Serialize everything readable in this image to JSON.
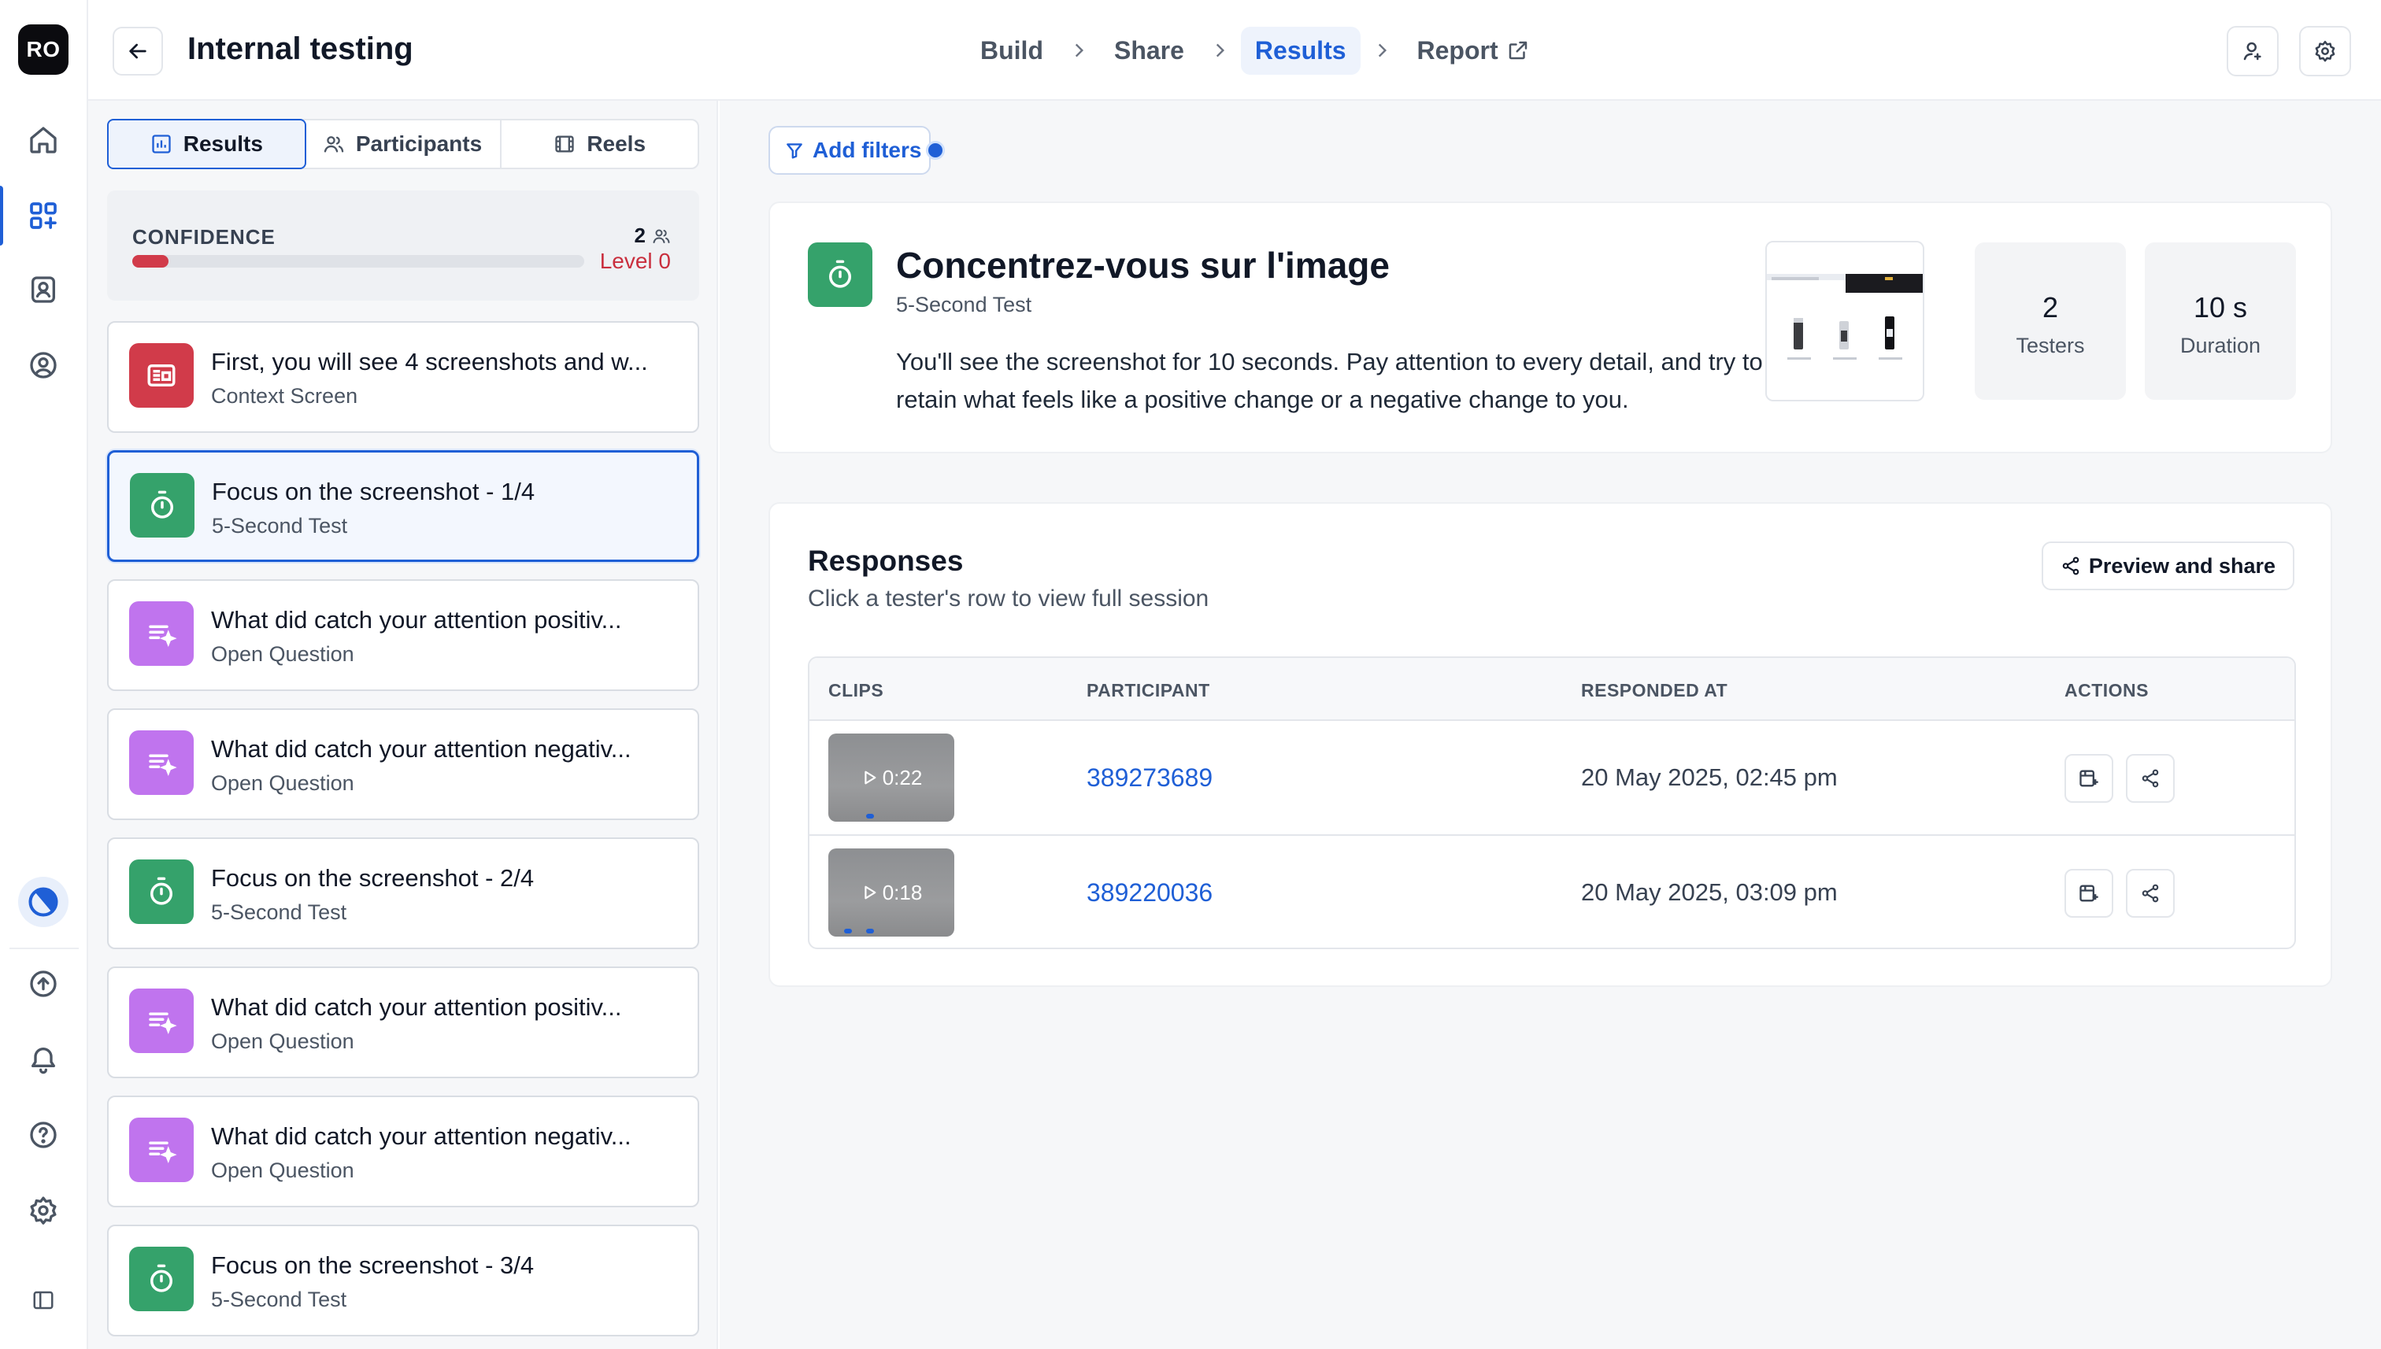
{
  "app": {
    "logo_text": "RO"
  },
  "header": {
    "title": "Internal testing",
    "breadcrumbs": [
      "Build",
      "Share",
      "Results",
      "Report"
    ],
    "active_crumb": "Results"
  },
  "left_panel": {
    "tabs": [
      {
        "label": "Results",
        "icon": "bar-chart-icon",
        "active": true
      },
      {
        "label": "Participants",
        "icon": "users-icon",
        "active": false
      },
      {
        "label": "Reels",
        "icon": "film-icon",
        "active": false
      }
    ],
    "confidence": {
      "label": "CONFIDENCE",
      "count": "2",
      "level": "Level 0",
      "fill_fraction": 0.08
    },
    "steps": [
      {
        "title": "First, you will see 4 screenshots and w...",
        "type": "Context Screen",
        "kind": "context",
        "color": "#d13b4a"
      },
      {
        "title": "Focus on the screenshot - 1/4",
        "type": "5-Second Test",
        "kind": "timer",
        "color": "#35a26b",
        "selected": true
      },
      {
        "title": "What did catch your attention positiv...",
        "type": "Open Question",
        "kind": "question",
        "color": "#c074ee"
      },
      {
        "title": "What did catch your attention negativ...",
        "type": "Open Question",
        "kind": "question",
        "color": "#c074ee"
      },
      {
        "title": "Focus on the screenshot - 2/4",
        "type": "5-Second Test",
        "kind": "timer",
        "color": "#35a26b"
      },
      {
        "title": "What did catch your attention positiv...",
        "type": "Open Question",
        "kind": "question",
        "color": "#c074ee"
      },
      {
        "title": "What did catch your attention negativ...",
        "type": "Open Question",
        "kind": "question",
        "color": "#c074ee"
      },
      {
        "title": "Focus on the screenshot - 3/4",
        "type": "5-Second Test",
        "kind": "timer",
        "color": "#35a26b"
      }
    ]
  },
  "main": {
    "add_filters_label": "Add filters",
    "block": {
      "title": "Concentrez-vous sur l'image",
      "type": "5-Second Test",
      "description": "You'll see the screenshot for 10 seconds. Pay attention to every detail, and try to retain what feels like a positive change or a negative change to you.",
      "stats": [
        {
          "value": "2",
          "label": "Testers"
        },
        {
          "value": "10 s",
          "label": "Duration"
        }
      ]
    },
    "responses": {
      "title": "Responses",
      "subtitle": "Click a tester's row to view full session",
      "share_label": "Preview and share",
      "columns": [
        "CLIPS",
        "PARTICIPANT",
        "RESPONDED AT",
        "ACTIONS"
      ],
      "rows": [
        {
          "clip_duration": "0:22",
          "participant": "389273689",
          "responded_at": "20 May 2025, 02:45 pm"
        },
        {
          "clip_duration": "0:18",
          "participant": "389220036",
          "responded_at": "20 May 2025, 03:09 pm"
        }
      ]
    }
  },
  "colors": {
    "accent": "#1f5fd6",
    "danger": "#d13b4a",
    "timer": "#35a26b",
    "question": "#c074ee"
  }
}
